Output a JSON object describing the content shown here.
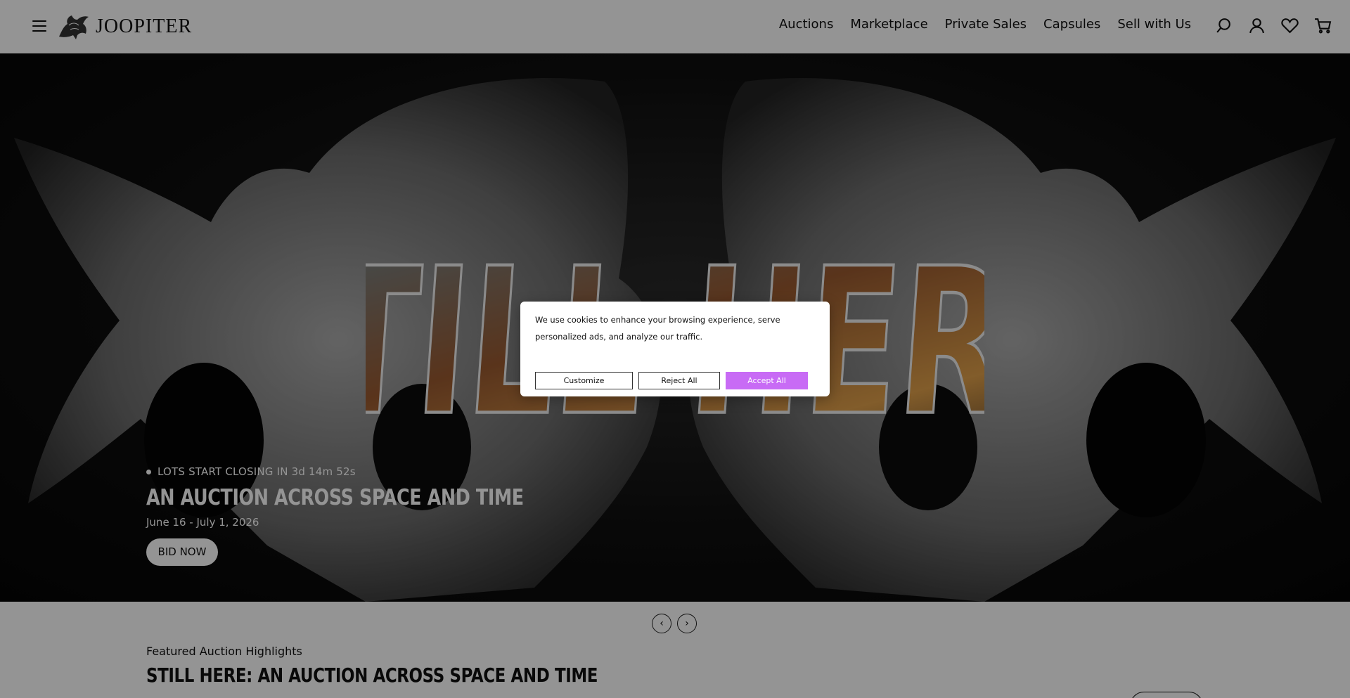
{
  "header": {
    "logo_text": "JOOPITER",
    "nav": [
      "Auctions",
      "Marketplace",
      "Private Sales",
      "Capsules",
      "Sell with Us"
    ]
  },
  "hero": {
    "art_title": "STILL HERE",
    "countdown": "LOTS START CLOSING IN 3d 14m 52s",
    "heading": "AN AUCTION ACROSS SPACE AND TIME",
    "dates": "June 16 - July 1, 2026",
    "cta": "BID NOW"
  },
  "carousel": {
    "prev": "‹",
    "next": "›"
  },
  "featured": {
    "subtitle": "Featured Auction Highlights",
    "title": "STILL HERE: AN AUCTION ACROSS SPACE AND TIME"
  },
  "cookie": {
    "text": "We use cookies to enhance your browsing experience, serve personalized ads, and analyze our traffic.",
    "customize_label": "Customize",
    "reject_label": "Reject All",
    "accept_label": "Accept All",
    "accent_color": "#c86bf5"
  }
}
